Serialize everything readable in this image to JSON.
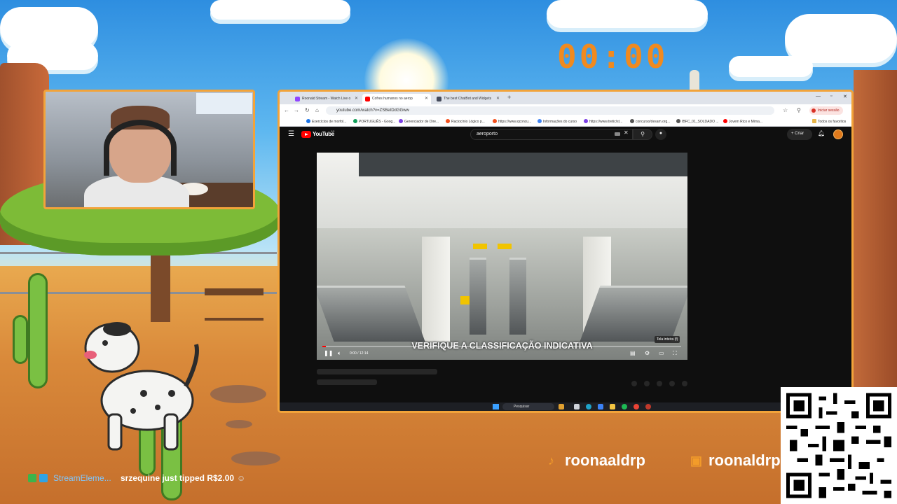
{
  "overlay": {
    "timer": "00:00",
    "socials": [
      {
        "platform": "tiktok",
        "icon": "tiktok-icon",
        "handle": "roonaaldrp"
      },
      {
        "platform": "twitch",
        "icon": "twitch-icon",
        "handle": "roonaldrp"
      }
    ],
    "tip": {
      "source": "StreamEleme...",
      "message": "srzequine just tipped R$2.00"
    },
    "accent_color": "#f2a33a",
    "timer_color": "#f08a1f"
  },
  "browser": {
    "tabs": [
      {
        "title": "Roonald Stream - Watch Live o",
        "active": false,
        "icon": "twitch-favicon"
      },
      {
        "title": "Cofres humanos no aerop",
        "active": true,
        "icon": "youtube-favicon"
      },
      {
        "title": "The best ChatBot and Widgets",
        "active": false,
        "icon": "streamelements-favicon"
      }
    ],
    "url": "youtube.com/watch?v=ZSBeIDdGGww",
    "profile_label": "Iniciar sessão",
    "bookmarks": [
      "Exercícios de morfol...",
      "PORTUGUÊS - Goog...",
      "Gerenciador de Dire...",
      "Raciocínio Lógico p...",
      "https://www.qconcu...",
      "Informações do curso",
      "https://www.tretic/st...",
      "concurso/desam.org...",
      "IBFC_01_SOLDADO ...",
      "Jovem Rico e Mima...",
      "Todos os favoritos"
    ]
  },
  "youtube": {
    "logo_text": "YouTube",
    "country": "BR",
    "search_query": "aeroporto",
    "create_label": "Criar",
    "video": {
      "subtitle": "VERIFIQUE A CLASSIFICAÇÃO INDICATIVA",
      "current_time": "0:00",
      "duration": "12:14",
      "time_display": "0:00 / 12:14",
      "progress": 0.0,
      "tooltip": "Tela inteira (f)"
    }
  },
  "taskbar": {
    "search_placeholder": "Pesquisar"
  }
}
